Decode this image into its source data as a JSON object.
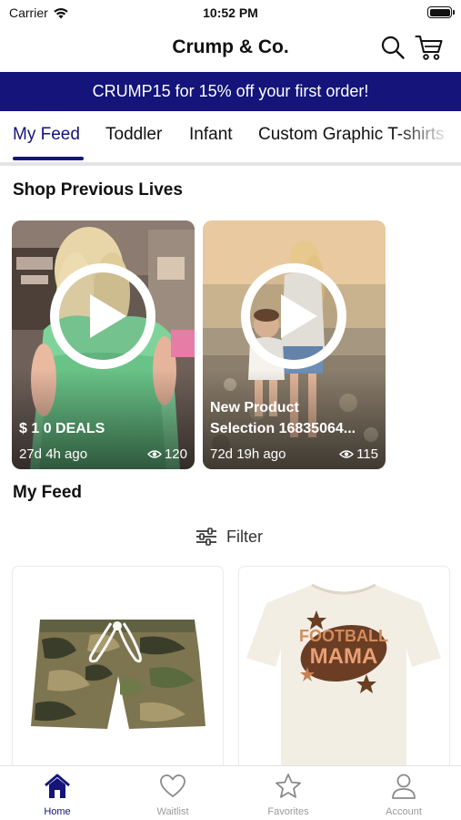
{
  "status_bar": {
    "carrier": "Carrier",
    "time": "10:52 PM"
  },
  "header": {
    "title": "Crump & Co.",
    "search_icon": "search-icon",
    "cart_icon": "cart-icon"
  },
  "promo": {
    "text": "CRUMP15 for 15% off your first order!",
    "color": "#14147a"
  },
  "tabs": [
    {
      "label": "My Feed",
      "active": true
    },
    {
      "label": "Toddler"
    },
    {
      "label": "Infant"
    },
    {
      "label": "Custom Graphic T-shirts"
    }
  ],
  "previous_lives": {
    "title": "Shop Previous Lives",
    "items": [
      {
        "caption_lines": [
          "$ 1 0 DEALS"
        ],
        "age": "27d 4h ago",
        "views": "120"
      },
      {
        "caption_lines": [
          "New Product",
          "Selection 16835064..."
        ],
        "age": "72d 19h ago",
        "views": "115"
      }
    ]
  },
  "feed": {
    "title": "My Feed",
    "filter_label": "Filter",
    "products": [
      {
        "image": "camo-shorts"
      },
      {
        "image": "football-mama-tshirt",
        "graphic_text": [
          "FOOTBALL",
          "MAMA"
        ]
      }
    ]
  },
  "tab_bar": [
    {
      "label": "Home",
      "icon": "home-icon",
      "active": true
    },
    {
      "label": "Waitlist",
      "icon": "heart-icon"
    },
    {
      "label": "Favorites",
      "icon": "star-icon"
    },
    {
      "label": "Account",
      "icon": "person-icon"
    }
  ],
  "colors": {
    "accent": "#14147a",
    "inactive": "#9a9a9a"
  }
}
